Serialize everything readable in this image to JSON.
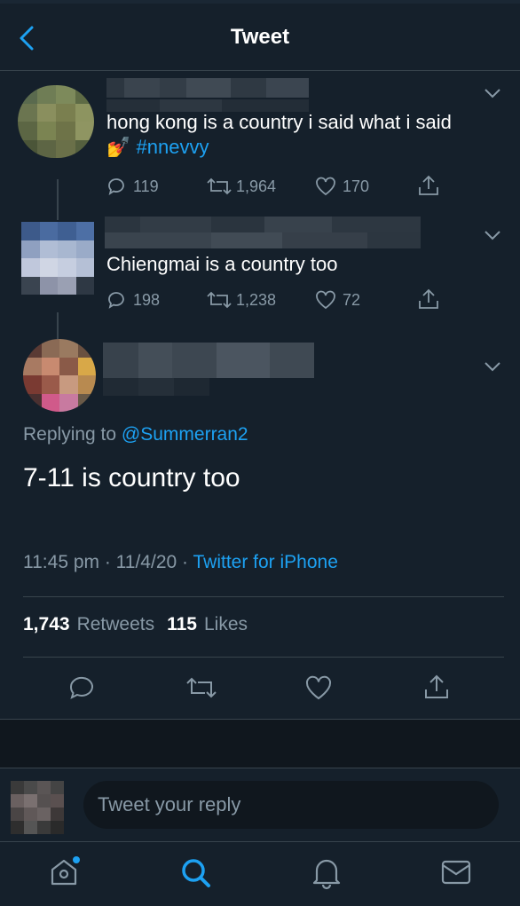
{
  "header": {
    "title": "Tweet",
    "back_icon": "chevron-left-icon"
  },
  "colors": {
    "background": "#15202b",
    "accent": "#1da1f2",
    "secondary_text": "#8899a6",
    "border": "#38444d"
  },
  "thread": [
    {
      "text": "hong kong is a country i said what i said",
      "emoji": "💅",
      "hashtag": "#nnevvy",
      "replies": "119",
      "retweets": "1,964",
      "likes": "170"
    },
    {
      "text": "Chiengmai is a country too",
      "replies": "198",
      "retweets": "1,238",
      "likes": "72"
    }
  ],
  "main_tweet": {
    "replying_prefix": "Replying to",
    "replying_to": "@Summerran2",
    "text": "7-11 is country too",
    "time": "11:45 pm",
    "date": "11/4/20",
    "source": "Twitter for iPhone",
    "retweet_count": "1,743",
    "retweet_label": "Retweets",
    "like_count": "115",
    "like_label": "Likes"
  },
  "reply_box": {
    "placeholder": "Tweet your reply"
  },
  "tabs": [
    "home-icon",
    "search-icon",
    "notifications-icon",
    "messages-icon"
  ]
}
